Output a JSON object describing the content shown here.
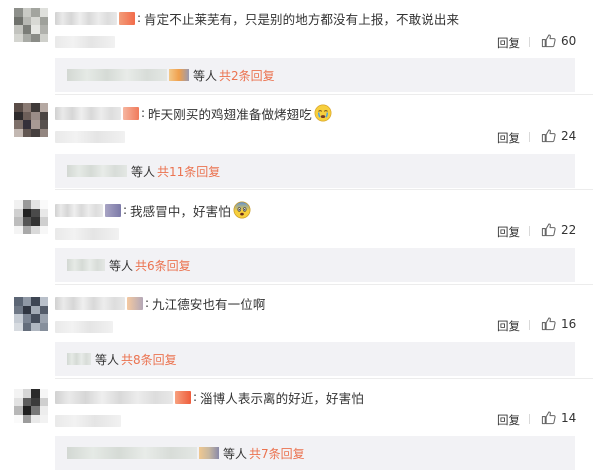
{
  "comments": [
    {
      "text": "肯定不止莱芜有，只是别的地方都没有上报，不敢说出来",
      "reply_label": "回复",
      "like_icon": "thumbs-up-icon",
      "likes": "60",
      "sub_people": "等人",
      "sub_replies": "共2条回复"
    },
    {
      "text": "昨天刚买的鸡翅准备做烤翅吃",
      "emoji": "crying-face-emoji",
      "reply_label": "回复",
      "like_icon": "thumbs-up-icon",
      "likes": "24",
      "sub_people": "等人",
      "sub_replies": "共11条回复"
    },
    {
      "text": "我感冒中，好害怕",
      "emoji": "fearful-face-emoji",
      "reply_label": "回复",
      "like_icon": "thumbs-up-icon",
      "likes": "22",
      "sub_people": "等人",
      "sub_replies": "共6条回复"
    },
    {
      "text": "九江德安也有一位啊",
      "reply_label": "回复",
      "like_icon": "thumbs-up-icon",
      "likes": "16",
      "sub_people": "等人",
      "sub_replies": "共8条回复"
    },
    {
      "text": "淄博人表示离的好近，好害怕",
      "reply_label": "回复",
      "like_icon": "thumbs-up-icon",
      "likes": "14",
      "sub_people": "等人",
      "sub_replies": "共7条回复"
    }
  ],
  "colors": {
    "link": "#eb7350",
    "text": "#333333",
    "sub_box_bg": "#f2f2f5"
  }
}
